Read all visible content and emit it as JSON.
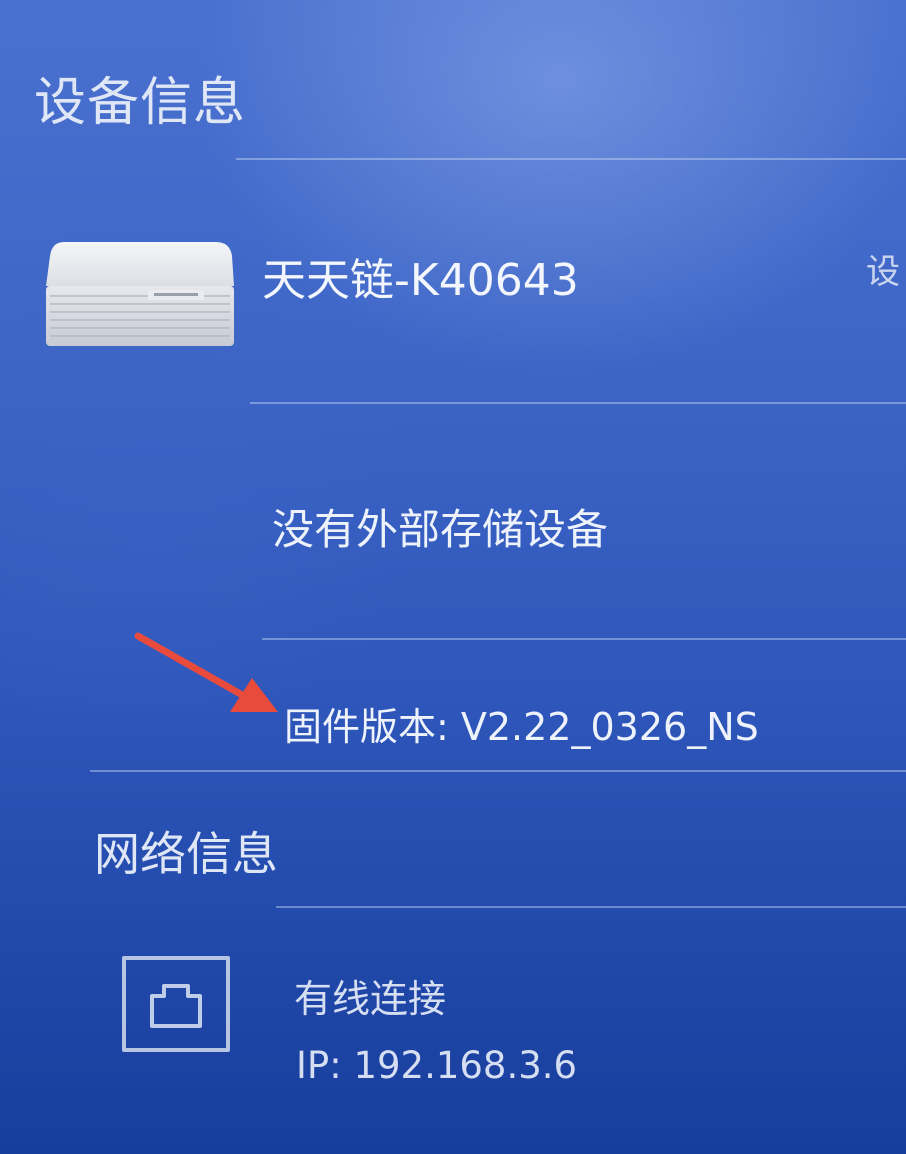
{
  "device_section": {
    "title": "设备信息",
    "device_name": "天天链-K40643",
    "side_action_partial": "设",
    "storage_status": "没有外部存储设备",
    "firmware": "固件版本: V2.22_0326_NS"
  },
  "network_section": {
    "title": "网络信息",
    "connection_type": "有线连接",
    "ip": "IP: 192.168.3.6"
  },
  "colors": {
    "background": "#3e66c7",
    "arrow": "#e84b3c"
  },
  "icons": [
    "router-device-icon",
    "ethernet-port-icon",
    "red-arrow-annotation"
  ]
}
